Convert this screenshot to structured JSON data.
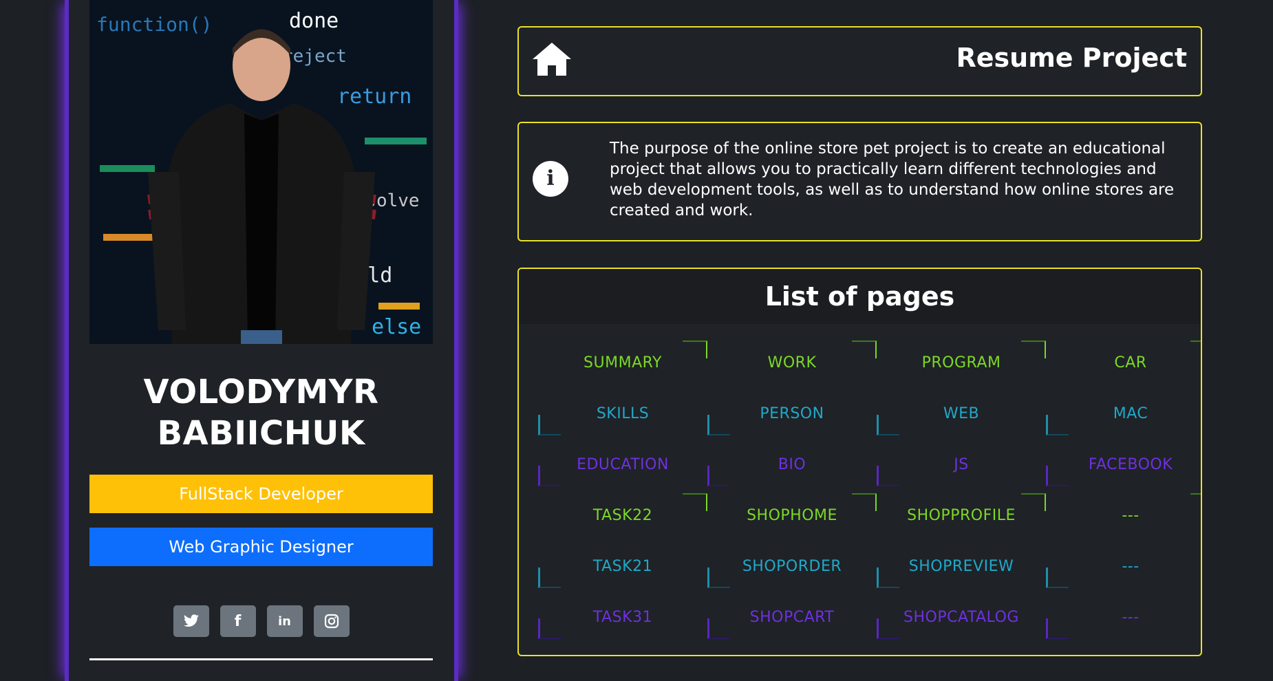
{
  "profile": {
    "name_line1": "VOLODYMYR",
    "name_line2": "BABIICHUK",
    "role_primary": "FullStack Developer",
    "role_secondary": "Web Graphic Designer",
    "socials": [
      {
        "icon": "twitter-icon",
        "glyph": "t"
      },
      {
        "icon": "facebook-icon",
        "glyph": "f"
      },
      {
        "icon": "linkedin-icon",
        "glyph": "in"
      },
      {
        "icon": "instagram-icon",
        "glyph": "◎"
      }
    ],
    "photo_code_text": [
      "function()",
      "return",
      "reject",
      "done",
      "else",
      "Child",
      "resolve"
    ]
  },
  "header": {
    "title": "Resume Project",
    "icon": "home-icon"
  },
  "info": {
    "icon": "info-icon",
    "glyph": "i",
    "text": "The purpose of the online store pet project is to create an educational project that allows you to practically learn different technologies and web development tools, as well as to understand how online stores are created and work."
  },
  "pages": {
    "title": "List of pages",
    "rows": [
      [
        "SUMMARY",
        "WORK",
        "PROGRAM",
        "CAR"
      ],
      [
        "SKILLS",
        "PERSON",
        "WEB",
        "MAC"
      ],
      [
        "EDUCATION",
        "BIO",
        "JS",
        "FACEBOOK"
      ],
      [
        "TASK22",
        "SHOPHOME",
        "SHOPPROFILE",
        "---"
      ],
      [
        "TASK21",
        "SHOPORDER",
        "SHOPREVIEW",
        "---"
      ],
      [
        "TASK31",
        "SHOPCART",
        "SHOPCATALOG",
        "---"
      ]
    ]
  },
  "colors": {
    "accent_border": "#e8e22a",
    "green": "#7cd926",
    "cyan": "#1fa9c9",
    "purple": "#6f30e0",
    "role_primary_bg": "#ffc107",
    "role_secondary_bg": "#0d6efd"
  }
}
